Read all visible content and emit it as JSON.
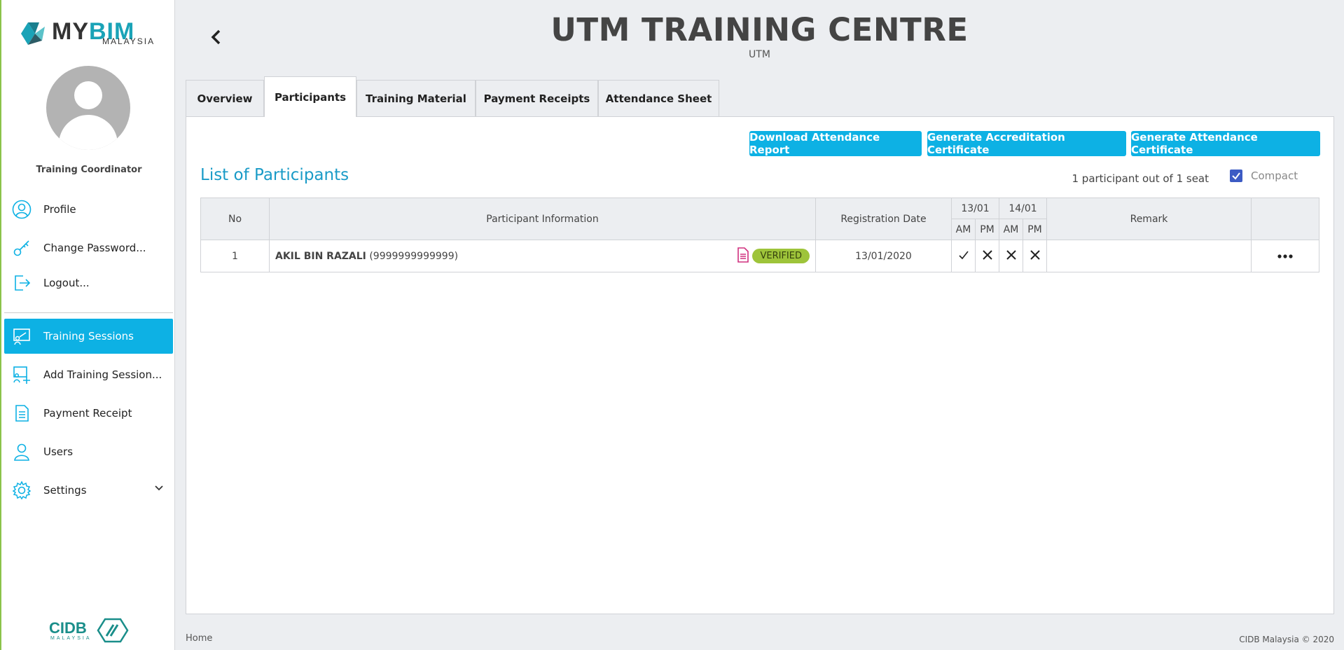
{
  "brand": {
    "logo_main": "MY",
    "logo_accent": "BIM",
    "logo_sub": "MALAYSIA",
    "footer_logo": "CIDB",
    "footer_logo_sub": "MALAYSIA"
  },
  "user": {
    "role": "Training Coordinator"
  },
  "menu": {
    "profile": "Profile",
    "change_password": "Change Password...",
    "logout": "Logout...",
    "training_sessions": "Training Sessions",
    "add_training_session": "Add Training Session...",
    "payment_receipt": "Payment Receipt",
    "users": "Users",
    "settings": "Settings"
  },
  "header": {
    "title": "UTM TRAINING CENTRE",
    "subtitle": "UTM"
  },
  "tabs": [
    "Overview",
    "Participants",
    "Training Material",
    "Payment Receipts",
    "Attendance Sheet"
  ],
  "active_tab": "Participants",
  "actions": {
    "download_report": "Download Attendance Report",
    "accreditation": "Generate Accreditation Certificate",
    "attendance_cert": "Generate Attendance Certificate"
  },
  "list": {
    "title": "List of Participants",
    "count": "1 participant out of 1 seat",
    "compact_label": "Compact",
    "compact_checked": true
  },
  "table": {
    "headers": {
      "no": "No",
      "info": "Participant Information",
      "reg_date": "Registration Date",
      "day1": "13/01",
      "day2": "14/01",
      "am": "AM",
      "pm": "PM",
      "remark": "Remark"
    },
    "rows": [
      {
        "no": "1",
        "name": "AKIL BIN RAZALI",
        "ic": "(9999999999999)",
        "status": "VERIFIED",
        "reg_date": "13/01/2020",
        "attendance": [
          "present",
          "absent",
          "absent",
          "absent"
        ],
        "remark": ""
      }
    ]
  },
  "footer": {
    "breadcrumb": "Home",
    "copyright": "CIDB Malaysia © 2020"
  },
  "colors": {
    "accent": "#0db1e4",
    "verified": "#9ec43a",
    "title_blue": "#1a9bc7",
    "checkbox": "#3c5bc4"
  }
}
